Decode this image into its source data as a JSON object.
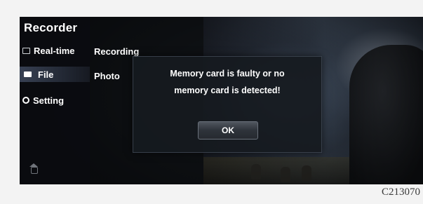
{
  "menu": {
    "title": "Recorder",
    "items": [
      {
        "label": "Real-time",
        "icon": "realtime-icon",
        "selected": false
      },
      {
        "label": "File",
        "icon": "folder-icon",
        "selected": true
      },
      {
        "label": "Setting",
        "icon": "setting-icon",
        "selected": false
      }
    ],
    "home_icon": "home-icon"
  },
  "submenu": {
    "items": [
      {
        "label": "Recording"
      },
      {
        "label": "Photo"
      }
    ]
  },
  "dialog": {
    "message_line1": "Memory card is faulty or no",
    "message_line2": "memory card is detected!",
    "ok_label": "OK"
  },
  "figure_code": "C213070"
}
